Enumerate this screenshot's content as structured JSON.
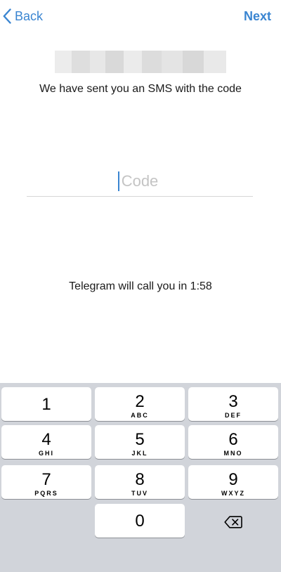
{
  "nav": {
    "back_label": "Back",
    "next_label": "Next"
  },
  "sms_message": "We have sent you an SMS with the code",
  "code_field": {
    "placeholder": "Code",
    "value": ""
  },
  "call_message": "Telegram will call you in 1:58",
  "keypad": {
    "keys": [
      {
        "digit": "1",
        "letters": ""
      },
      {
        "digit": "2",
        "letters": "ABC"
      },
      {
        "digit": "3",
        "letters": "DEF"
      },
      {
        "digit": "4",
        "letters": "GHI"
      },
      {
        "digit": "5",
        "letters": "JKL"
      },
      {
        "digit": "6",
        "letters": "MNO"
      },
      {
        "digit": "7",
        "letters": "PQRS"
      },
      {
        "digit": "8",
        "letters": "TUV"
      },
      {
        "digit": "9",
        "letters": "WXYZ"
      },
      {
        "digit": "0",
        "letters": ""
      }
    ],
    "delete_icon": "backspace-icon"
  },
  "colors": {
    "accent": "#3a85d1",
    "keyboard_background": "#d1d4da",
    "key_background": "#ffffff"
  }
}
